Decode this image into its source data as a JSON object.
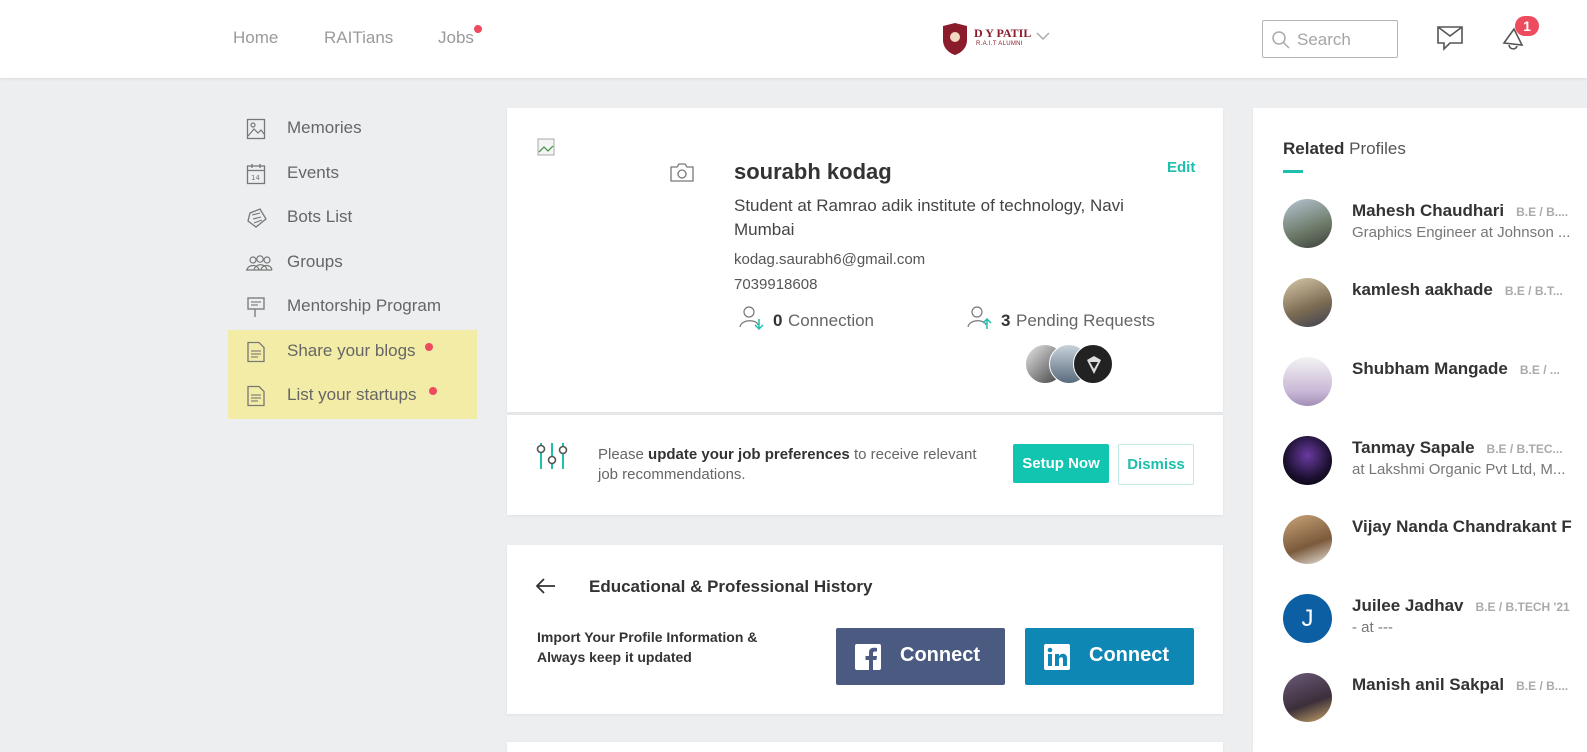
{
  "nav": {
    "home": "Home",
    "raitians": "RAITians",
    "jobs": "Jobs"
  },
  "brand": {
    "name": "D Y PATIL",
    "sub": "R.A.I.T ALUMNI"
  },
  "search": {
    "placeholder": "Search"
  },
  "notifications": {
    "count": "1"
  },
  "sidebar": {
    "items": [
      {
        "label": "Memories"
      },
      {
        "label": "Events"
      },
      {
        "label": "Bots List"
      },
      {
        "label": "Groups"
      },
      {
        "label": "Mentorship Program"
      },
      {
        "label": "Share your blogs"
      },
      {
        "label": "List your startups"
      }
    ]
  },
  "profile": {
    "name": "sourabh kodag",
    "edit": "Edit",
    "headline": "Student at Ramrao adik institute of technology, Navi Mumbai",
    "email": "kodag.saurabh6@gmail.com",
    "phone": "7039918608",
    "connections_count": "0",
    "connections_label": "Connection",
    "pending_count": "3",
    "pending_label": "Pending Requests"
  },
  "job_prefs": {
    "text_pre": "Please",
    "text_bold": "update your job preferences",
    "text_post": "to receive relevant job recommendations.",
    "setup": "Setup Now",
    "dismiss": "Dismiss"
  },
  "history": {
    "title": "Educational & Professional History",
    "import_line1": "Import Your Profile Information &",
    "import_line2": "Always keep it updated",
    "fb_connect": "Connect",
    "li_connect": "Connect"
  },
  "related": {
    "title_bold": "Related",
    "title_rest": "Profiles",
    "people": [
      {
        "name": "Mahesh Chaudhari",
        "degree": "B.E / B....",
        "sub": "Graphics Engineer at Johnson ..."
      },
      {
        "name": "kamlesh aakhade",
        "degree": "B.E / B.T...",
        "sub": ""
      },
      {
        "name": "Shubham Mangade",
        "degree": "B.E / ...",
        "sub": ""
      },
      {
        "name": "Tanmay Sapale",
        "degree": "B.E / B.TEC...",
        "sub": "at Lakshmi Organic Pvt Ltd, M..."
      },
      {
        "name": "Vijay Nanda Chandrakant F",
        "degree": "",
        "sub": ""
      },
      {
        "name": "Juilee Jadhav",
        "degree": "B.E / B.TECH '21",
        "sub": "- at ---",
        "initial": "J"
      },
      {
        "name": "Manish anil Sakpal",
        "degree": "B.E / B....",
        "sub": ""
      }
    ]
  },
  "colors": {
    "accent": "#11c5b0",
    "alert": "#ef4b5f",
    "facebook": "#4a5a80",
    "linkedin": "#0e87b5",
    "highlight": "#f3eca6"
  }
}
